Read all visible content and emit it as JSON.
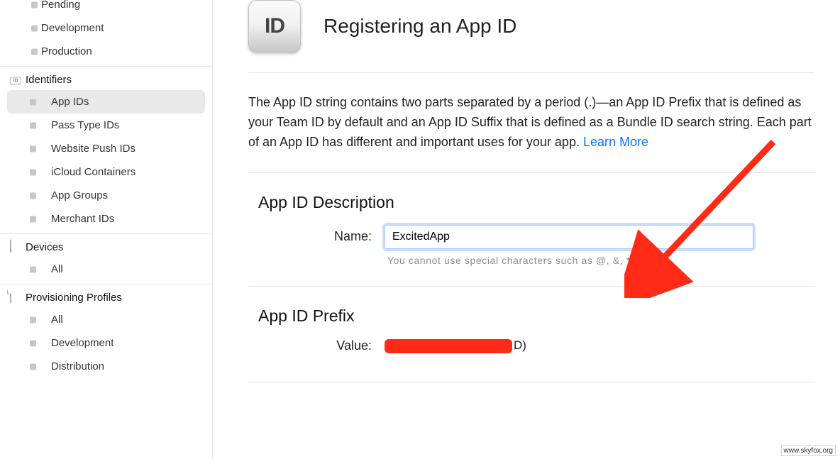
{
  "sidebar": {
    "top_items": [
      "Pending",
      "Development",
      "Production"
    ],
    "sections": [
      {
        "title": "Identifiers",
        "icon": "id-card",
        "items": [
          "App IDs",
          "Pass Type IDs",
          "Website Push IDs",
          "iCloud Containers",
          "App Groups",
          "Merchant IDs"
        ],
        "active": "App IDs"
      },
      {
        "title": "Devices",
        "icon": "device",
        "items": [
          "All"
        ]
      },
      {
        "title": "Provisioning Profiles",
        "icon": "doc",
        "items": [
          "All",
          "Development",
          "Distribution"
        ]
      }
    ]
  },
  "page": {
    "badge_text": "ID",
    "title": "Registering an App ID",
    "intro": "The App ID string contains two parts separated by a period (.)—an App ID Prefix that is defined as your Team ID by default and an App ID Suffix that is defined as a Bundle ID search string. Each part of an App ID has different and important uses for your app. ",
    "learn_more": "Learn More"
  },
  "form": {
    "desc_section_title": "App ID Description",
    "name_label": "Name:",
    "name_value": "ExcitedApp",
    "name_hint": "You cannot use special characters such as @, &, *, ', \"",
    "prefix_section_title": "App ID Prefix",
    "value_label": "Value:",
    "value_suffix": "D)"
  },
  "watermark": "www.skyfox.org"
}
